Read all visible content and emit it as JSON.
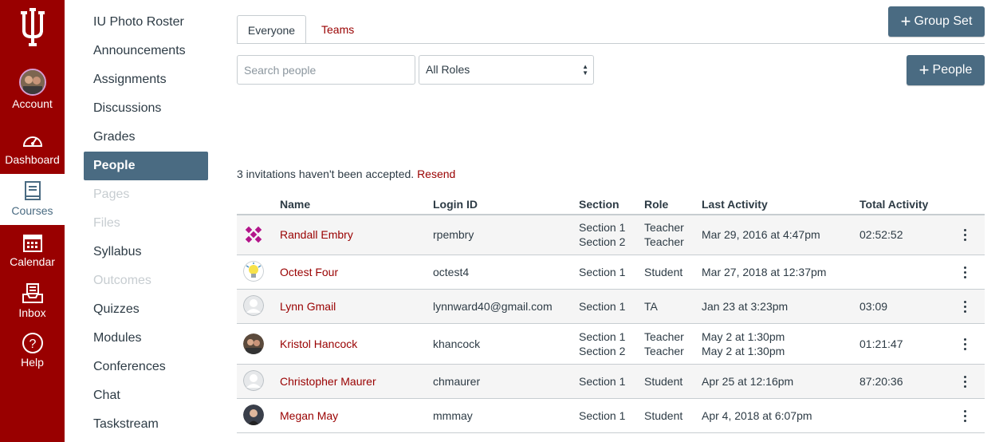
{
  "global_nav": {
    "items": [
      {
        "label": "Account",
        "icon": "avatar"
      },
      {
        "label": "Dashboard",
        "icon": "dashboard-icon"
      },
      {
        "label": "Courses",
        "icon": "courses-icon",
        "active": true
      },
      {
        "label": "Calendar",
        "icon": "calendar-icon"
      },
      {
        "label": "Inbox",
        "icon": "inbox-icon"
      },
      {
        "label": "Help",
        "icon": "help-icon"
      }
    ],
    "brand_color": "#990000"
  },
  "course_nav": {
    "items": [
      {
        "label": "IU Photo Roster"
      },
      {
        "label": "Announcements"
      },
      {
        "label": "Assignments"
      },
      {
        "label": "Discussions"
      },
      {
        "label": "Grades"
      },
      {
        "label": "People",
        "active": true
      },
      {
        "label": "Pages",
        "disabled": true
      },
      {
        "label": "Files",
        "disabled": true
      },
      {
        "label": "Syllabus"
      },
      {
        "label": "Outcomes",
        "disabled": true
      },
      {
        "label": "Quizzes"
      },
      {
        "label": "Modules"
      },
      {
        "label": "Conferences"
      },
      {
        "label": "Chat"
      },
      {
        "label": "Taskstream"
      }
    ]
  },
  "tabs": {
    "everyone": "Everyone",
    "teams": "Teams"
  },
  "buttons": {
    "group_set": "Group Set",
    "people": "People"
  },
  "search": {
    "placeholder": "Search people"
  },
  "role_filter": {
    "selected": "All Roles"
  },
  "invitations": {
    "text": "3 invitations haven't been accepted.",
    "resend": "Resend"
  },
  "table": {
    "headers": {
      "name": "Name",
      "login": "Login ID",
      "section": "Section",
      "role": "Role",
      "last": "Last Activity",
      "total": "Total Activity"
    },
    "rows": [
      {
        "name": "Randall Embry",
        "login": "rpembry",
        "section": [
          "Section 1",
          "Section 2"
        ],
        "role": [
          "Teacher",
          "Teacher"
        ],
        "last": [
          "Mar 29, 2016 at 4:47pm"
        ],
        "total": "02:52:52",
        "avatar": "pattern"
      },
      {
        "name": "Octest Four",
        "login": "octest4",
        "section": [
          "Section 1"
        ],
        "role": [
          "Student"
        ],
        "last": [
          "Mar 27, 2018 at 12:37pm"
        ],
        "total": "",
        "avatar": "bulb"
      },
      {
        "name": "Lynn Gmail",
        "login": "lynnward40@gmail.com",
        "section": [
          "Section 1"
        ],
        "role": [
          "TA"
        ],
        "last": [
          "Jan 23 at 3:23pm"
        ],
        "total": "03:09",
        "avatar": "default"
      },
      {
        "name": "Kristol Hancock",
        "login": "khancock",
        "section": [
          "Section 1",
          "Section 2"
        ],
        "role": [
          "Teacher",
          "Teacher"
        ],
        "last": [
          "May 2 at 1:30pm",
          "May 2 at 1:30pm"
        ],
        "total": "01:21:47",
        "avatar": "photo"
      },
      {
        "name": "Christopher Maurer",
        "login": "chmaurer",
        "section": [
          "Section 1"
        ],
        "role": [
          "Student"
        ],
        "last": [
          "Apr 25 at 12:16pm"
        ],
        "total": "87:20:36",
        "avatar": "default"
      },
      {
        "name": "Megan May",
        "login": "mmmay",
        "section": [
          "Section 1"
        ],
        "role": [
          "Student"
        ],
        "last": [
          "Apr 4, 2018 at 6:07pm"
        ],
        "total": "",
        "avatar": "photo2"
      }
    ]
  }
}
